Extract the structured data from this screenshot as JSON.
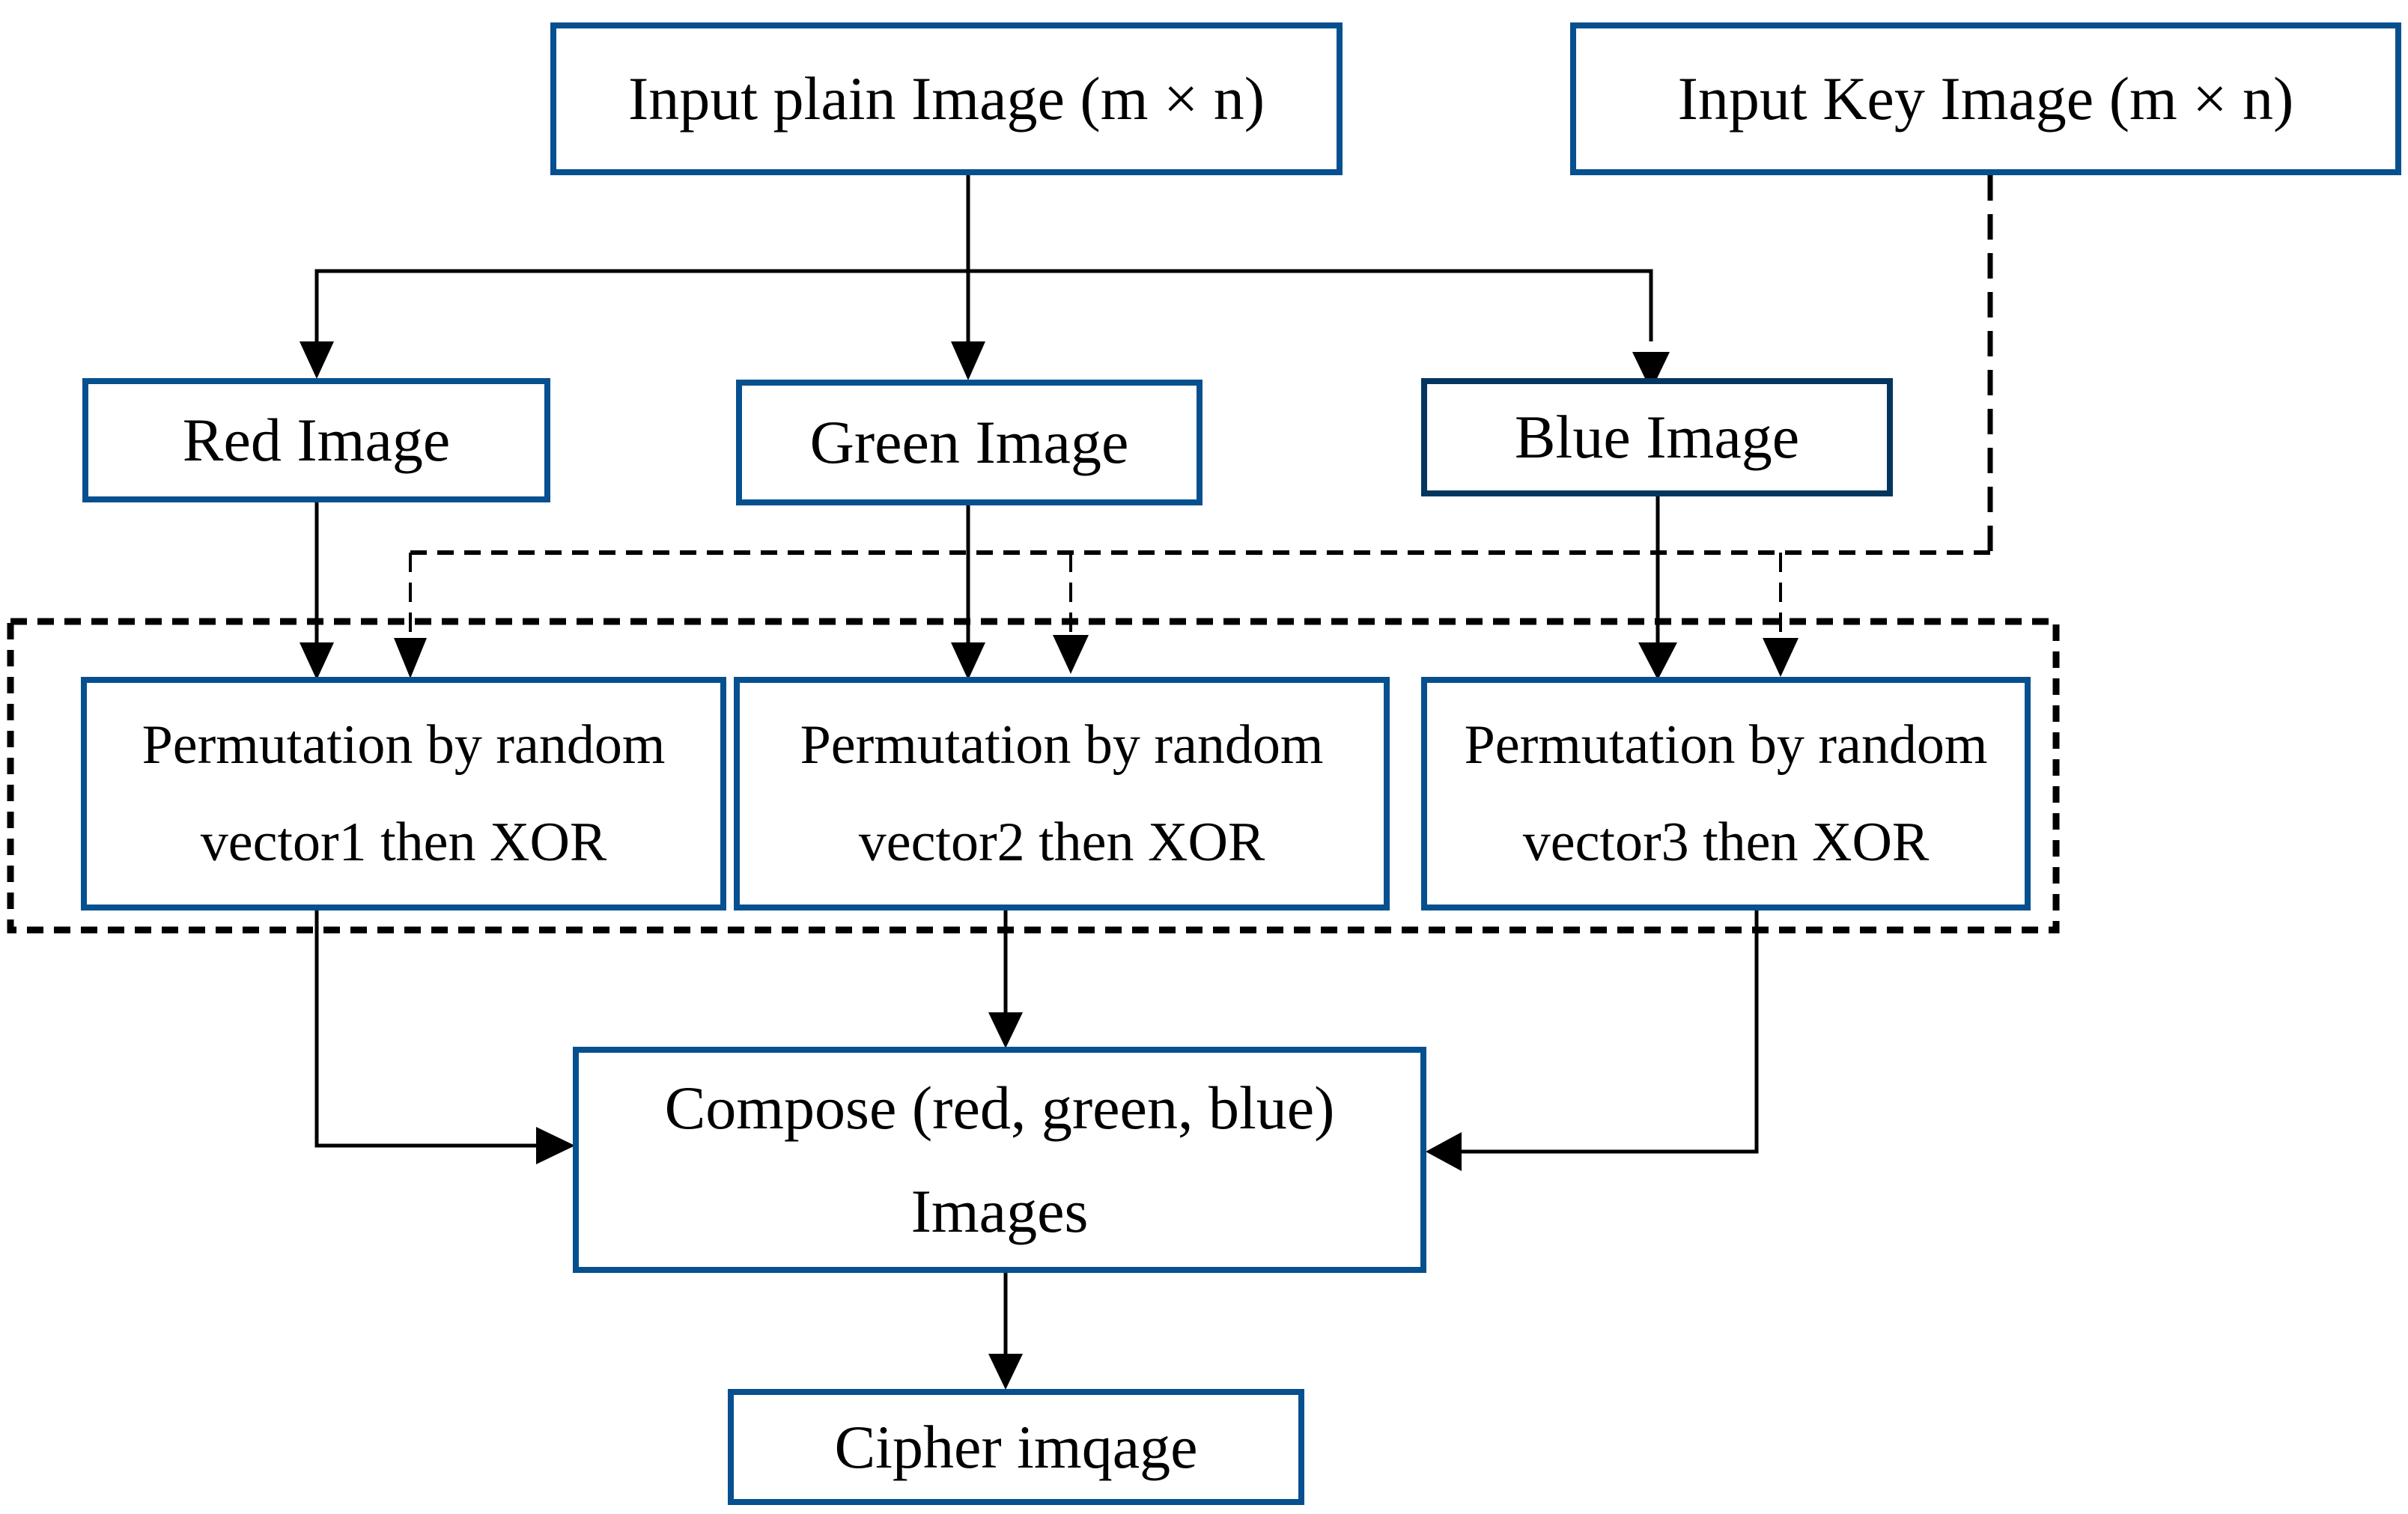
{
  "diagram": {
    "type": "flowchart",
    "colors": {
      "box_border": "#06508f",
      "box_border_dark": "#03365f",
      "line": "#000000",
      "background": "#ffffff"
    },
    "nodes": {
      "input_plain": {
        "label": "Input plain Image (m × n)"
      },
      "input_key": {
        "label": "Input Key Image (m × n)"
      },
      "red": {
        "label": "Red Image"
      },
      "green": {
        "label": "Green Image"
      },
      "blue": {
        "label": "Blue Image"
      },
      "perm1": {
        "line1": "Permutation by random",
        "line2": "vector1 then XOR"
      },
      "perm2": {
        "line1": "Permutation by random",
        "line2": "vector2 then XOR"
      },
      "perm3": {
        "line1": "Permutation by random",
        "line2": "vector3 then XOR"
      },
      "compose": {
        "line1": "Compose (red, green, blue)",
        "line2": "Images"
      },
      "cipher": {
        "label": "Cipher imqage"
      }
    },
    "edges": [
      {
        "from": "input_plain",
        "to": "red",
        "style": "solid"
      },
      {
        "from": "input_plain",
        "to": "green",
        "style": "solid"
      },
      {
        "from": "input_plain",
        "to": "blue",
        "style": "solid"
      },
      {
        "from": "red",
        "to": "perm1",
        "style": "solid"
      },
      {
        "from": "green",
        "to": "perm2",
        "style": "solid"
      },
      {
        "from": "blue",
        "to": "perm3",
        "style": "solid"
      },
      {
        "from": "input_key",
        "to": "perm1",
        "style": "dashed"
      },
      {
        "from": "input_key",
        "to": "perm2",
        "style": "dashed"
      },
      {
        "from": "input_key",
        "to": "perm3",
        "style": "dashed"
      },
      {
        "from": "perm1",
        "to": "compose",
        "style": "solid"
      },
      {
        "from": "perm2",
        "to": "compose",
        "style": "solid"
      },
      {
        "from": "perm3",
        "to": "compose",
        "style": "solid"
      },
      {
        "from": "compose",
        "to": "cipher",
        "style": "solid"
      }
    ],
    "groups": [
      {
        "name": "permutation-stage",
        "members": [
          "perm1",
          "perm2",
          "perm3"
        ],
        "style": "dashed"
      }
    ]
  }
}
